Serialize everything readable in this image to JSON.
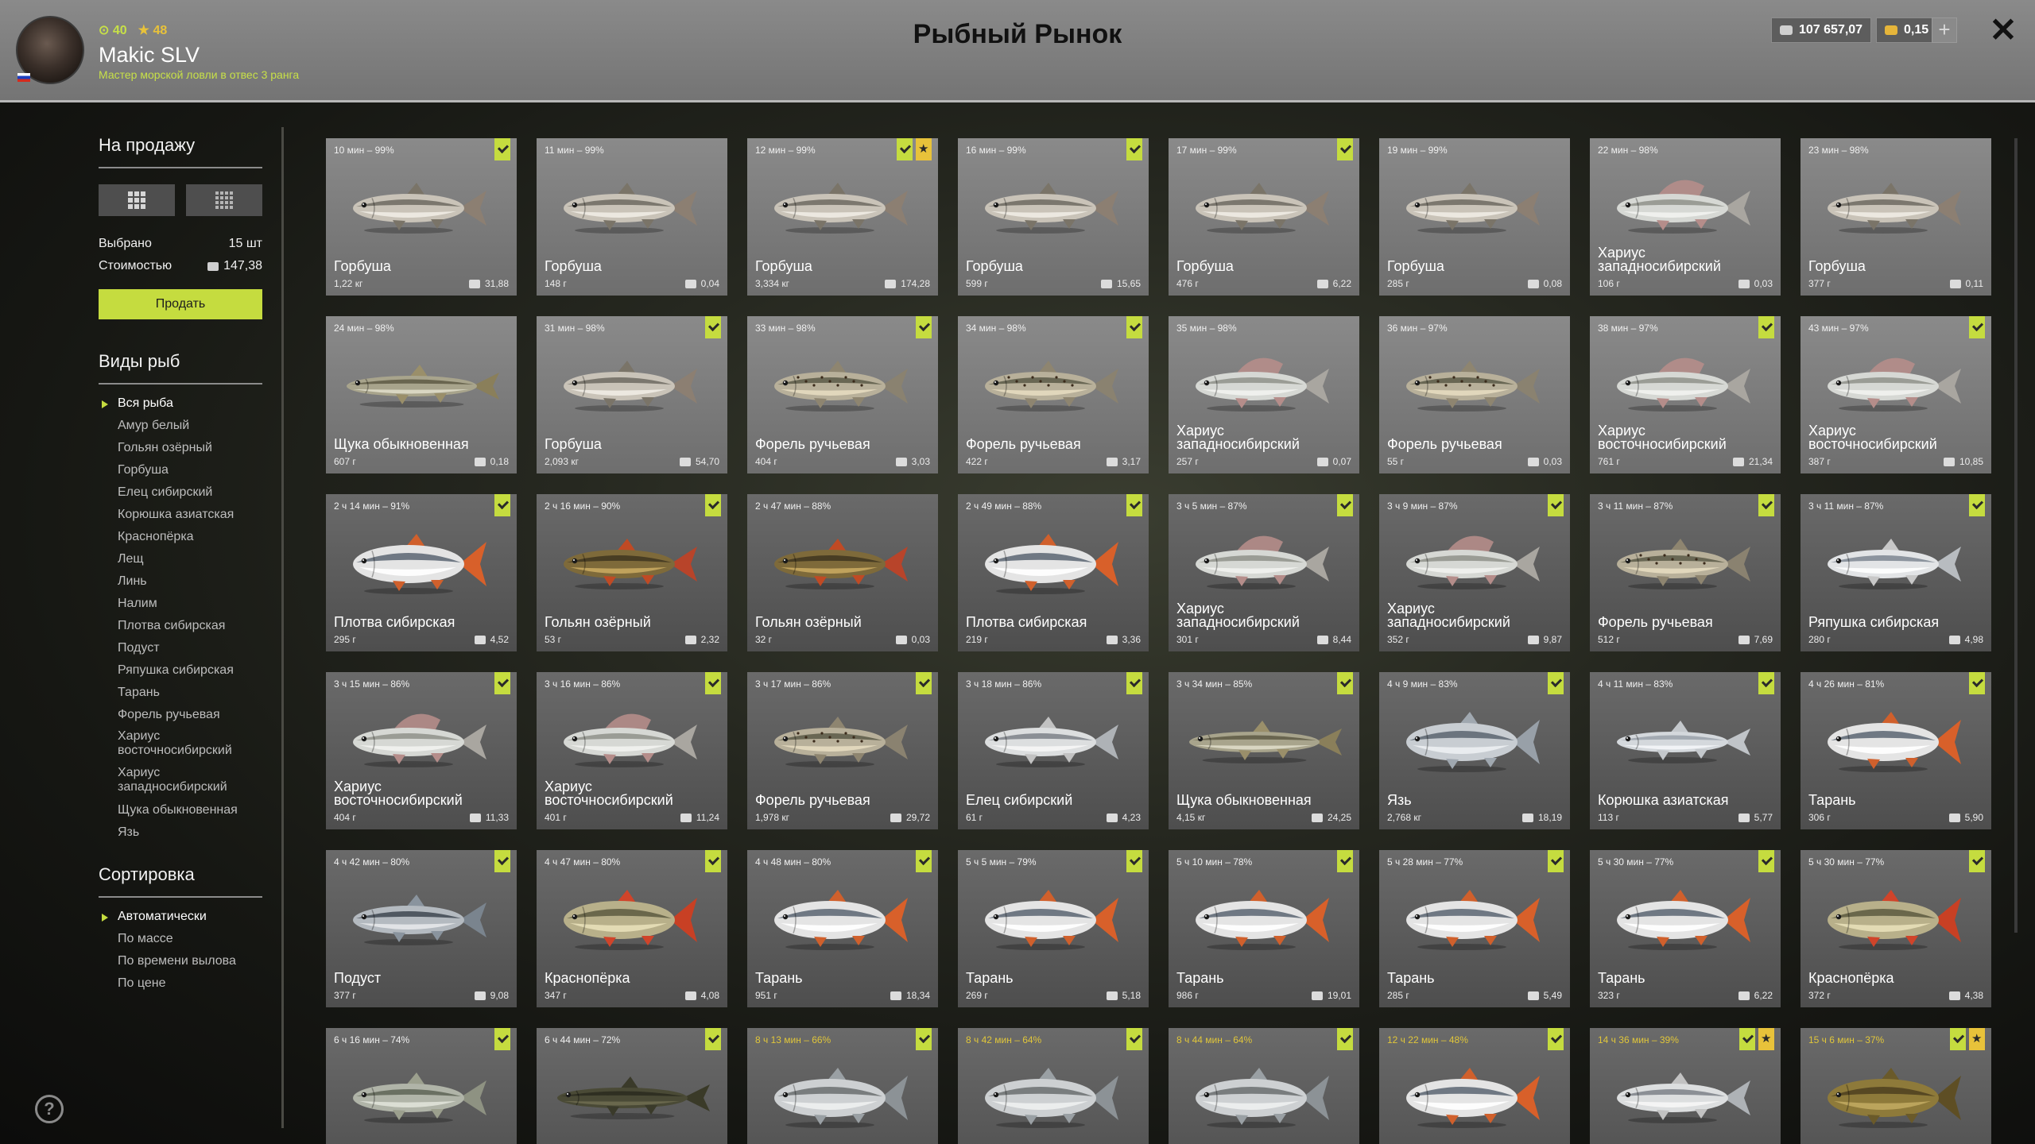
{
  "header": {
    "title": "Рыбный Рынок",
    "player": {
      "level": "40",
      "stars": "48",
      "name": "Makic SLV",
      "rank": "Мастер морской ловли в отвес 3 ранга"
    },
    "currency": {
      "silver": "107 657,07",
      "gold": "0,15",
      "add": "+"
    },
    "close": "✕"
  },
  "sidebar": {
    "for_sale_title": "На продажу",
    "selected_label": "Выбрано",
    "selected_value": "15 шт",
    "cost_label": "Стоимостью",
    "cost_value": "147,38",
    "sell_button": "Продать",
    "species_title": "Виды рыб",
    "species": [
      "Вся рыба",
      "Амур белый",
      "Гольян озёрный",
      "Горбуша",
      "Елец сибирский",
      "Корюшка азиатская",
      "Краснопёрка",
      "Лещ",
      "Линь",
      "Налим",
      "Плотва сибирская",
      "Подуст",
      "Ряпушка сибирская",
      "Тарань",
      "Форель ручьевая",
      "Хариус восточносибирский",
      "Хариус западносибирский",
      "Щука обыкновенная",
      "Язь"
    ],
    "sort_title": "Сортировка",
    "sort_options": [
      "Автоматически",
      "По массе",
      "По времени вылова",
      "По цене"
    ],
    "help": "?"
  },
  "colors": {
    "accent": "#c5dc3f",
    "gold": "#e8c23a",
    "header_bg": "#7a7a7a"
  },
  "cards": [
    {
      "time": "10 мин – 99%",
      "name": "Горбуша",
      "weight": "1,22 кг",
      "price": "31,88",
      "badges": [
        "check"
      ],
      "fish": "salmon"
    },
    {
      "time": "11 мин – 99%",
      "name": "Горбуша",
      "weight": "148 г",
      "price": "0,04",
      "badges": [],
      "fish": "salmon"
    },
    {
      "time": "12 мин – 99%",
      "name": "Горбуша",
      "weight": "3,334 кг",
      "price": "174,28",
      "badges": [
        "check",
        "star"
      ],
      "fish": "salmon"
    },
    {
      "time": "16 мин – 99%",
      "name": "Горбуша",
      "weight": "599 г",
      "price": "15,65",
      "badges": [
        "check"
      ],
      "fish": "salmon"
    },
    {
      "time": "17 мин – 99%",
      "name": "Горбуша",
      "weight": "476 г",
      "price": "6,22",
      "badges": [
        "check"
      ],
      "fish": "salmon"
    },
    {
      "time": "19 мин – 99%",
      "name": "Горбуша",
      "weight": "285 г",
      "price": "0,08",
      "badges": [],
      "fish": "salmon"
    },
    {
      "time": "22 мин – 98%",
      "name": "Хариус западносибирский",
      "weight": "106 г",
      "price": "0,03",
      "badges": [],
      "fish": "grayling"
    },
    {
      "time": "23 мин – 98%",
      "name": "Горбуша",
      "weight": "377 г",
      "price": "0,11",
      "badges": [],
      "fish": "salmon"
    },
    {
      "time": "24 мин – 98%",
      "name": "Щука обыкновенная",
      "weight": "607 г",
      "price": "0,18",
      "badges": [],
      "fish": "pike"
    },
    {
      "time": "31 мин – 98%",
      "name": "Горбуша",
      "weight": "2,093 кг",
      "price": "54,70",
      "badges": [
        "check"
      ],
      "fish": "salmon"
    },
    {
      "time": "33 мин – 98%",
      "name": "Форель ручьевая",
      "weight": "404 г",
      "price": "3,03",
      "badges": [
        "check"
      ],
      "fish": "trout"
    },
    {
      "time": "34 мин – 98%",
      "name": "Форель ручьевая",
      "weight": "422 г",
      "price": "3,17",
      "badges": [
        "check"
      ],
      "fish": "trout"
    },
    {
      "time": "35 мин – 98%",
      "name": "Хариус западносибирский",
      "weight": "257 г",
      "price": "0,07",
      "badges": [],
      "fish": "grayling"
    },
    {
      "time": "36 мин – 97%",
      "name": "Форель ручьевая",
      "weight": "55 г",
      "price": "0,03",
      "badges": [],
      "fish": "trout"
    },
    {
      "time": "38 мин – 97%",
      "name": "Хариус восточносибирский",
      "weight": "761 г",
      "price": "21,34",
      "badges": [
        "check"
      ],
      "fish": "grayling"
    },
    {
      "time": "43 мин – 97%",
      "name": "Хариус восточносибирский",
      "weight": "387 г",
      "price": "10,85",
      "badges": [
        "check"
      ],
      "fish": "grayling"
    },
    {
      "time": "2 ч 14 мин – 91%",
      "name": "Плотва сибирская",
      "weight": "295 г",
      "price": "4,52",
      "badges": [
        "check"
      ],
      "fish": "roach"
    },
    {
      "time": "2 ч 16 мин – 90%",
      "name": "Гольян озёрный",
      "weight": "53 г",
      "price": "2,32",
      "badges": [
        "check"
      ],
      "fish": "minnow"
    },
    {
      "time": "2 ч 47 мин – 88%",
      "name": "Гольян озёрный",
      "weight": "32 г",
      "price": "0,03",
      "badges": [],
      "fish": "minnow"
    },
    {
      "time": "2 ч 49 мин – 88%",
      "name": "Плотва сибирская",
      "weight": "219 г",
      "price": "3,36",
      "badges": [
        "check"
      ],
      "fish": "roach"
    },
    {
      "time": "3 ч 5 мин – 87%",
      "name": "Хариус западносибирский",
      "weight": "301 г",
      "price": "8,44",
      "badges": [
        "check"
      ],
      "fish": "grayling"
    },
    {
      "time": "3 ч 9 мин – 87%",
      "name": "Хариус западносибирский",
      "weight": "352 г",
      "price": "9,87",
      "badges": [
        "check"
      ],
      "fish": "grayling"
    },
    {
      "time": "3 ч 11 мин – 87%",
      "name": "Форель ручьевая",
      "weight": "512 г",
      "price": "7,69",
      "badges": [
        "check"
      ],
      "fish": "trout"
    },
    {
      "time": "3 ч 11 мин – 87%",
      "name": "Ряпушка сибирская",
      "weight": "280 г",
      "price": "4,98",
      "badges": [
        "check"
      ],
      "fish": "vendace"
    },
    {
      "time": "3 ч 15 мин – 86%",
      "name": "Хариус восточносибирский",
      "weight": "404 г",
      "price": "11,33",
      "badges": [
        "check"
      ],
      "fish": "grayling"
    },
    {
      "time": "3 ч 16 мин – 86%",
      "name": "Хариус восточносибирский",
      "weight": "401 г",
      "price": "11,24",
      "badges": [
        "check"
      ],
      "fish": "grayling"
    },
    {
      "time": "3 ч 17 мин – 86%",
      "name": "Форель ручьевая",
      "weight": "1,978 кг",
      "price": "29,72",
      "badges": [
        "check"
      ],
      "fish": "trout"
    },
    {
      "time": "3 ч 18 мин – 86%",
      "name": "Елец сибирский",
      "weight": "61 г",
      "price": "4,23",
      "badges": [
        "check"
      ],
      "fish": "dace"
    },
    {
      "time": "3 ч 34 мин – 85%",
      "name": "Щука обыкновенная",
      "weight": "4,15 кг",
      "price": "24,25",
      "badges": [
        "check"
      ],
      "fish": "pike"
    },
    {
      "time": "4 ч 9 мин – 83%",
      "name": "Язь",
      "weight": "2,768 кг",
      "price": "18,19",
      "badges": [
        "check"
      ],
      "fish": "ide"
    },
    {
      "time": "4 ч 11 мин – 83%",
      "name": "Корюшка азиатская",
      "weight": "113 г",
      "price": "5,77",
      "badges": [
        "check"
      ],
      "fish": "smelt"
    },
    {
      "time": "4 ч 26 мин – 81%",
      "name": "Тарань",
      "weight": "306 г",
      "price": "5,90",
      "badges": [
        "check"
      ],
      "fish": "roach"
    },
    {
      "time": "4 ч 42 мин – 80%",
      "name": "Подуст",
      "weight": "377 г",
      "price": "9,08",
      "badges": [
        "check"
      ],
      "fish": "nase"
    },
    {
      "time": "4 ч 47 мин – 80%",
      "name": "Краснопёрка",
      "weight": "347 г",
      "price": "4,08",
      "badges": [
        "check"
      ],
      "fish": "rudd"
    },
    {
      "time": "4 ч 48 мин – 80%",
      "name": "Тарань",
      "weight": "951 г",
      "price": "18,34",
      "badges": [
        "check"
      ],
      "fish": "roach"
    },
    {
      "time": "5 ч 5 мин – 79%",
      "name": "Тарань",
      "weight": "269 г",
      "price": "5,18",
      "badges": [
        "check"
      ],
      "fish": "roach"
    },
    {
      "time": "5 ч 10 мин – 78%",
      "name": "Тарань",
      "weight": "986 г",
      "price": "19,01",
      "badges": [
        "check"
      ],
      "fish": "roach"
    },
    {
      "time": "5 ч 28 мин – 77%",
      "name": "Тарань",
      "weight": "285 г",
      "price": "5,49",
      "badges": [
        "check"
      ],
      "fish": "roach"
    },
    {
      "time": "5 ч 30 мин – 77%",
      "name": "Тарань",
      "weight": "323 г",
      "price": "6,22",
      "badges": [
        "check"
      ],
      "fish": "roach"
    },
    {
      "time": "5 ч 30 мин – 77%",
      "name": "Краснопёрка",
      "weight": "372 г",
      "price": "4,38",
      "badges": [
        "check"
      ],
      "fish": "rudd"
    },
    {
      "time": "6 ч 16 мин – 74%",
      "name": "",
      "weight": "",
      "price": "",
      "badges": [
        "check"
      ],
      "fish": "carp"
    },
    {
      "time": "6 ч 44 мин – 72%",
      "name": "",
      "weight": "",
      "price": "",
      "badges": [
        "check"
      ],
      "fish": "burbot"
    },
    {
      "time": "8 ч 13 мин – 66%",
      "name": "",
      "weight": "",
      "price": "",
      "badges": [
        "check"
      ],
      "fish": "bream",
      "yellow": true
    },
    {
      "time": "8 ч 42 мин – 64%",
      "name": "",
      "weight": "",
      "price": "",
      "badges": [
        "check"
      ],
      "fish": "bream",
      "yellow": true
    },
    {
      "time": "8 ч 44 мин – 64%",
      "name": "",
      "weight": "",
      "price": "",
      "badges": [
        "check"
      ],
      "fish": "bream",
      "yellow": true
    },
    {
      "time": "12 ч 22 мин – 48%",
      "name": "",
      "weight": "",
      "price": "",
      "badges": [
        "check"
      ],
      "fish": "roach",
      "yellow": true
    },
    {
      "time": "14 ч 36 мин – 39%",
      "name": "",
      "weight": "",
      "price": "",
      "badges": [
        "check",
        "star"
      ],
      "fish": "dace",
      "yellow": true
    },
    {
      "time": "15 ч 6 мин – 37%",
      "name": "",
      "weight": "",
      "price": "",
      "badges": [
        "check",
        "star"
      ],
      "fish": "tench",
      "yellow": true
    }
  ]
}
